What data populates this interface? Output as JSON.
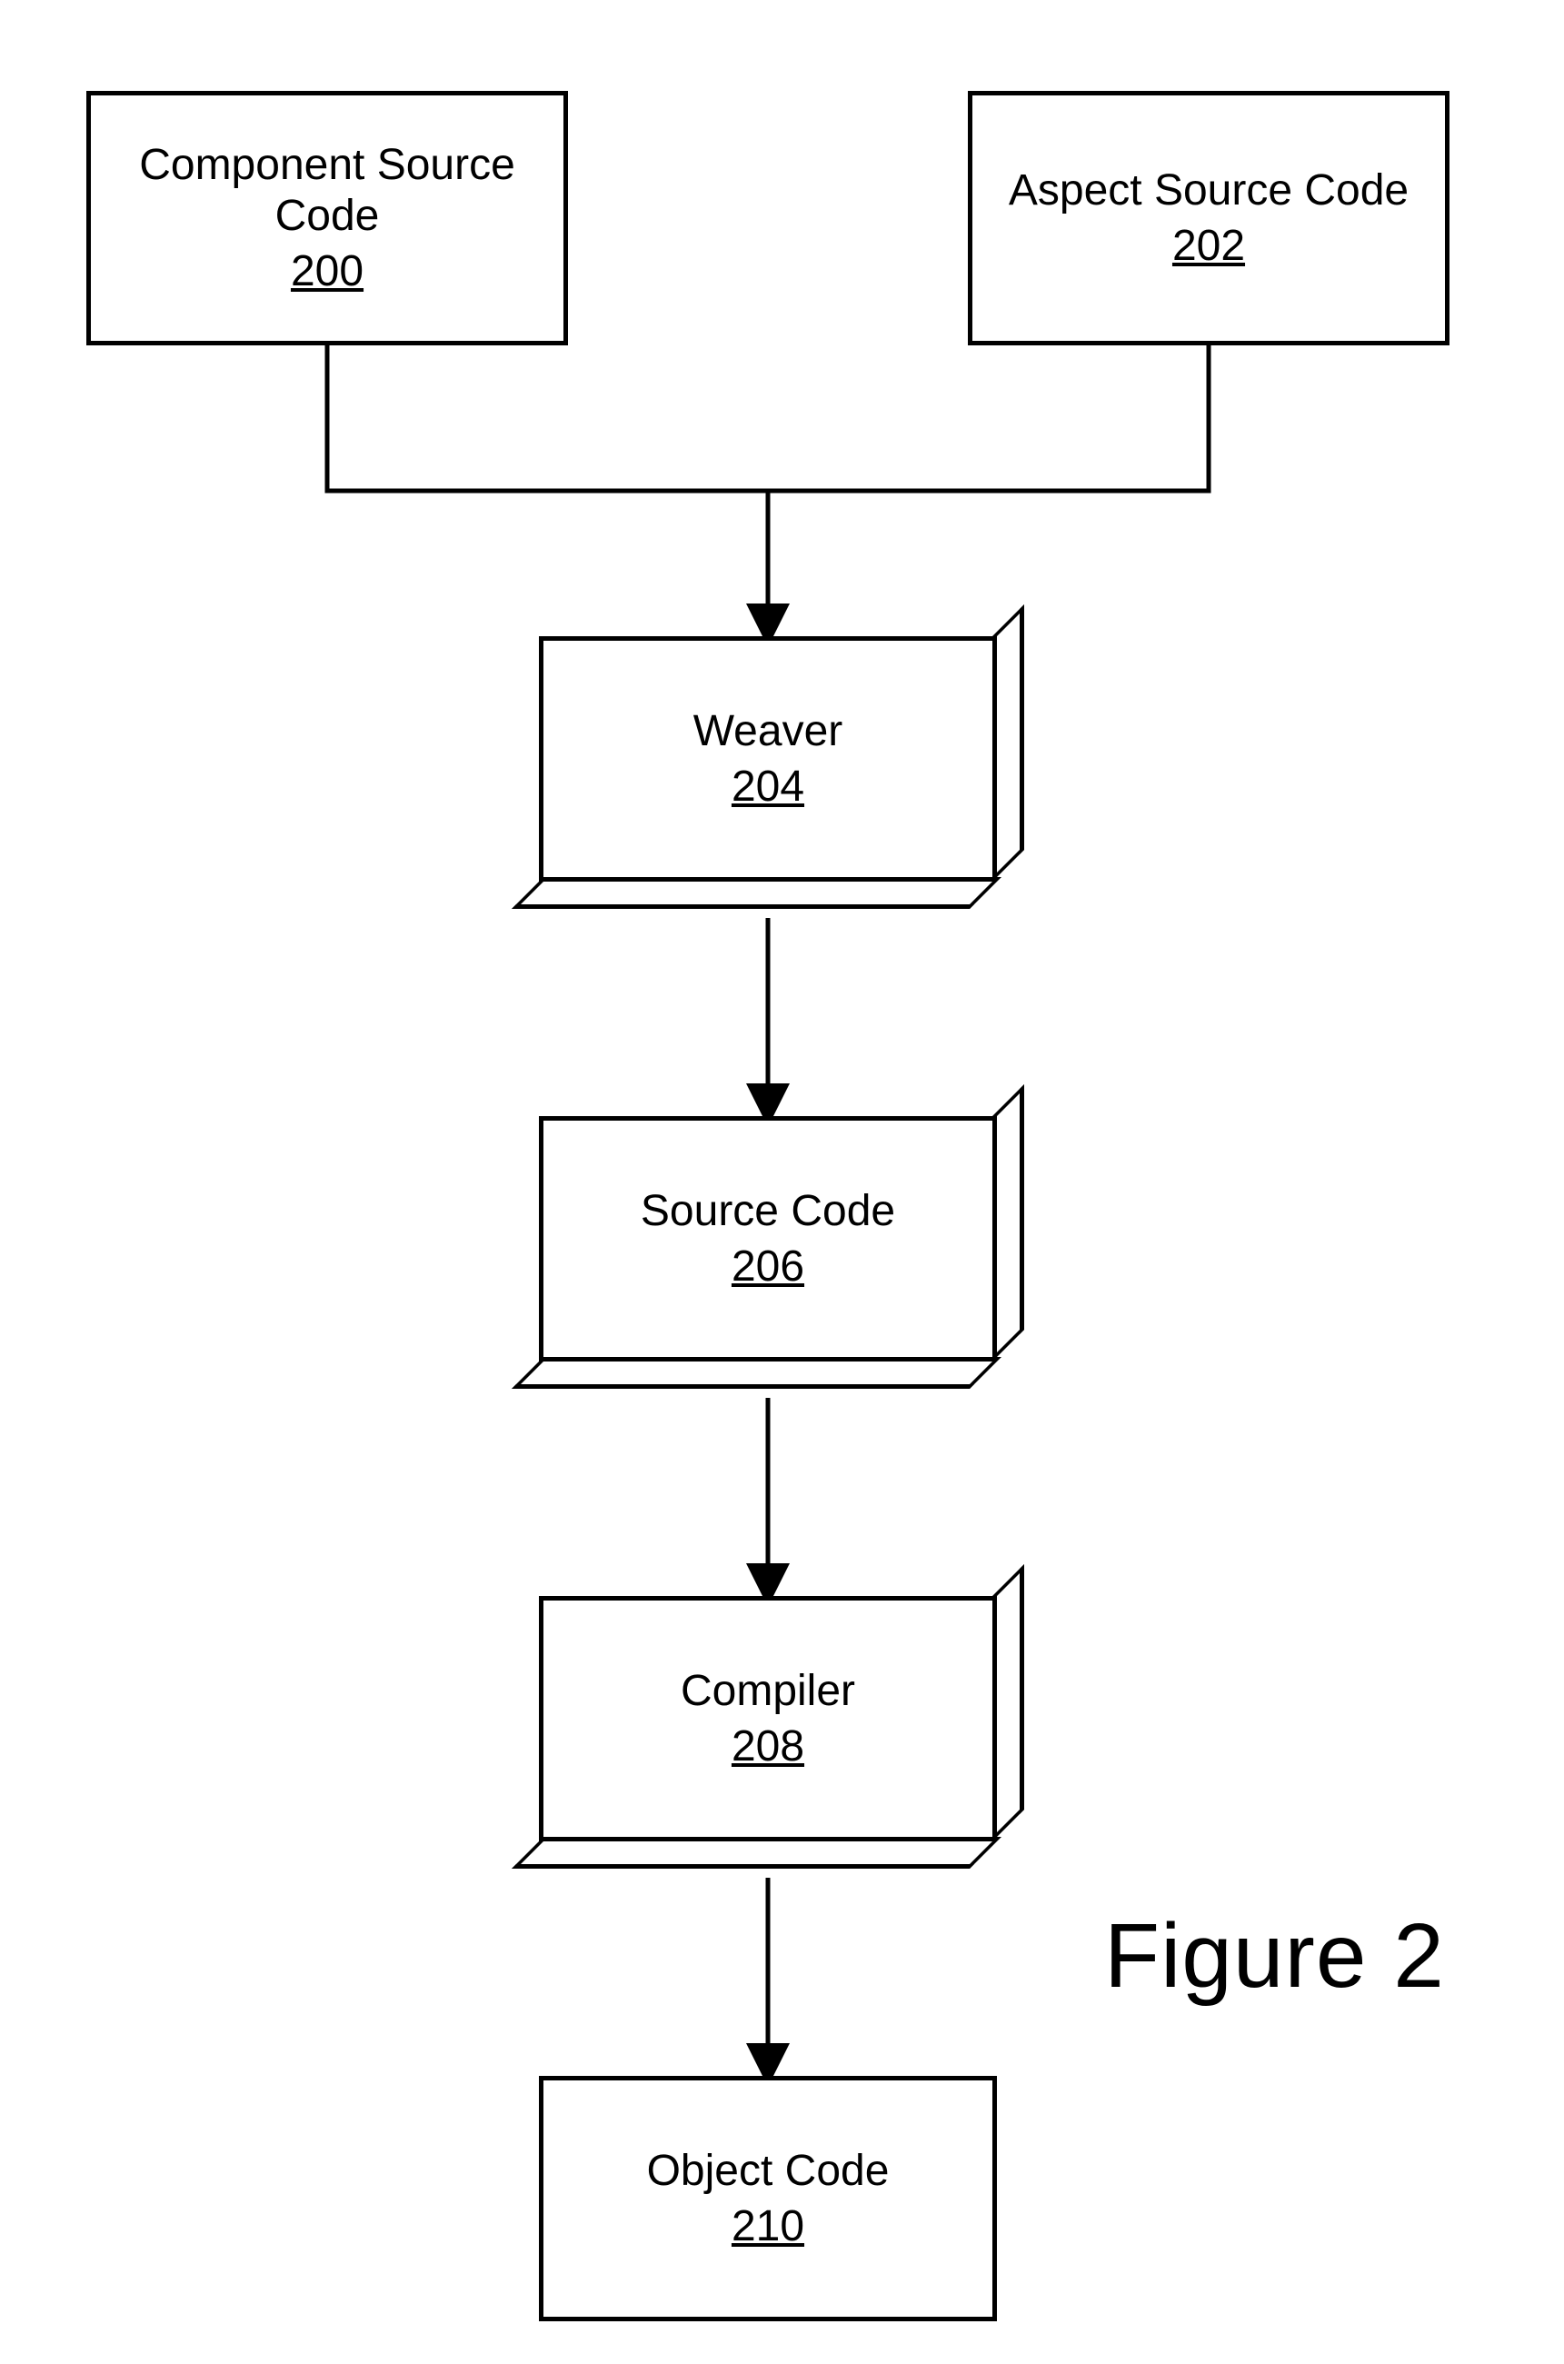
{
  "nodes": {
    "component_source": {
      "title": "Component Source Code",
      "num": "200"
    },
    "aspect_source": {
      "title": "Aspect Source Code",
      "num": "202"
    },
    "weaver": {
      "title": "Weaver",
      "num": "204"
    },
    "source_code": {
      "title": "Source Code",
      "num": "206"
    },
    "compiler": {
      "title": "Compiler",
      "num": "208"
    },
    "object_code": {
      "title": "Object Code",
      "num": "210"
    }
  },
  "caption": "Figure 2"
}
